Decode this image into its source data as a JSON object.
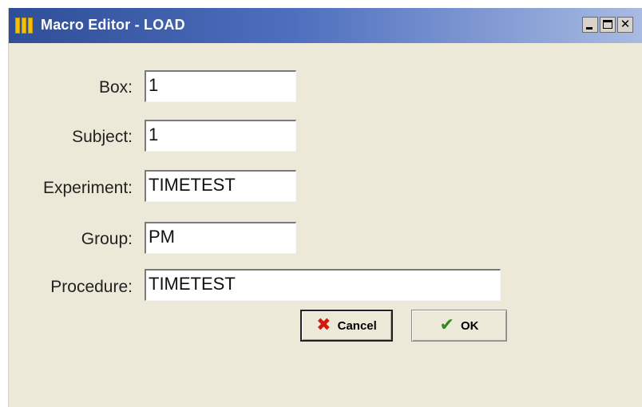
{
  "window": {
    "title": "Macro Editor - LOAD"
  },
  "titlebar_buttons": {
    "minimize": "minimize-icon",
    "maximize": "maximize-icon",
    "close": "close-icon"
  },
  "form": {
    "box": {
      "label": "Box:",
      "value": "1"
    },
    "subject": {
      "label": "Subject:",
      "value": "1"
    },
    "experiment": {
      "label": "Experiment:",
      "value": "TIMETEST"
    },
    "group": {
      "label": "Group:",
      "value": "PM"
    },
    "procedure": {
      "label": "Procedure:",
      "value": "TIMETEST"
    }
  },
  "buttons": {
    "cancel": {
      "label": "Cancel",
      "icon": "x-icon",
      "icon_color": "#d01a10"
    },
    "ok": {
      "label": "OK",
      "icon": "checkmark-icon",
      "icon_color": "#2e8b1e"
    }
  },
  "colors": {
    "titlebar": "#2f4e98",
    "window_bg": "#ece9d8"
  }
}
